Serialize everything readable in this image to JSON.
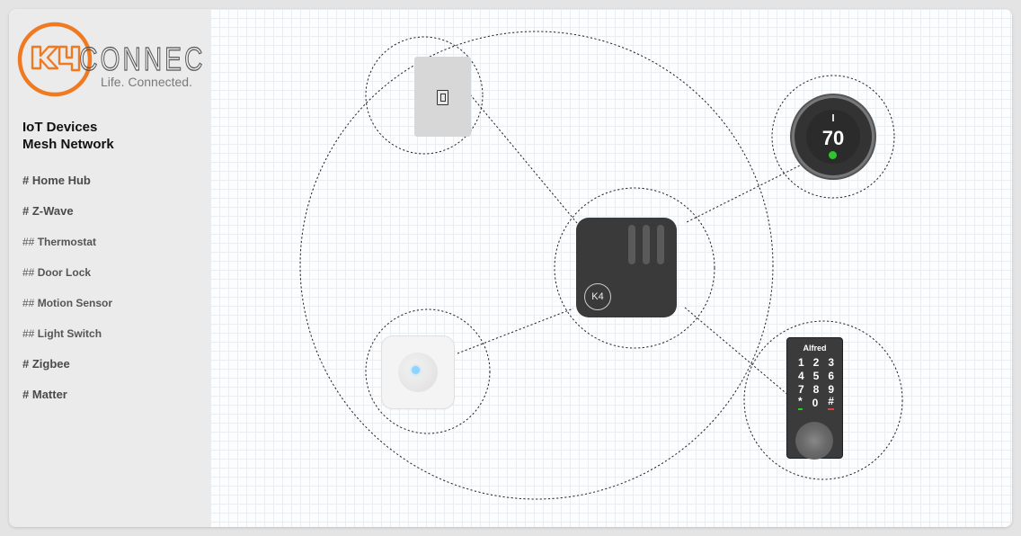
{
  "brand": {
    "logo_mark": "K4",
    "logo_word": "CONNECT",
    "tagline": "Life. Connected.",
    "accent_color": "#f07a22"
  },
  "sidebar": {
    "title_line1": "IoT Devices",
    "title_line2": "Mesh Network",
    "items": [
      {
        "prefix": "#",
        "label": "Home Hub",
        "level": 1
      },
      {
        "prefix": "#",
        "label": "Z-Wave",
        "level": 1
      },
      {
        "prefix": "##",
        "label": "Thermostat",
        "level": 2
      },
      {
        "prefix": "##",
        "label": "Door Lock",
        "level": 2
      },
      {
        "prefix": "##",
        "label": "Motion Sensor",
        "level": 2
      },
      {
        "prefix": "##",
        "label": "Light Switch",
        "level": 2
      },
      {
        "prefix": "#",
        "label": "Zigbee",
        "level": 1
      },
      {
        "prefix": "#",
        "label": "Matter",
        "level": 1
      }
    ]
  },
  "devices": {
    "hub": {
      "badge": "K4"
    },
    "thermostat": {
      "temperature": "70"
    },
    "lock": {
      "brand": "Alfred",
      "keys": [
        [
          "1",
          "2",
          "3"
        ],
        [
          "4",
          "5",
          "6"
        ],
        [
          "7",
          "8",
          "9"
        ],
        [
          "*",
          "0",
          "#"
        ]
      ]
    }
  },
  "colors": {
    "hub_body": "#3a3a3a",
    "status_green": "#2fc52f",
    "motion_led": "#8fd3ff",
    "key_star_underline": "#2fc52f",
    "key_hash_underline": "#e83b3b"
  }
}
